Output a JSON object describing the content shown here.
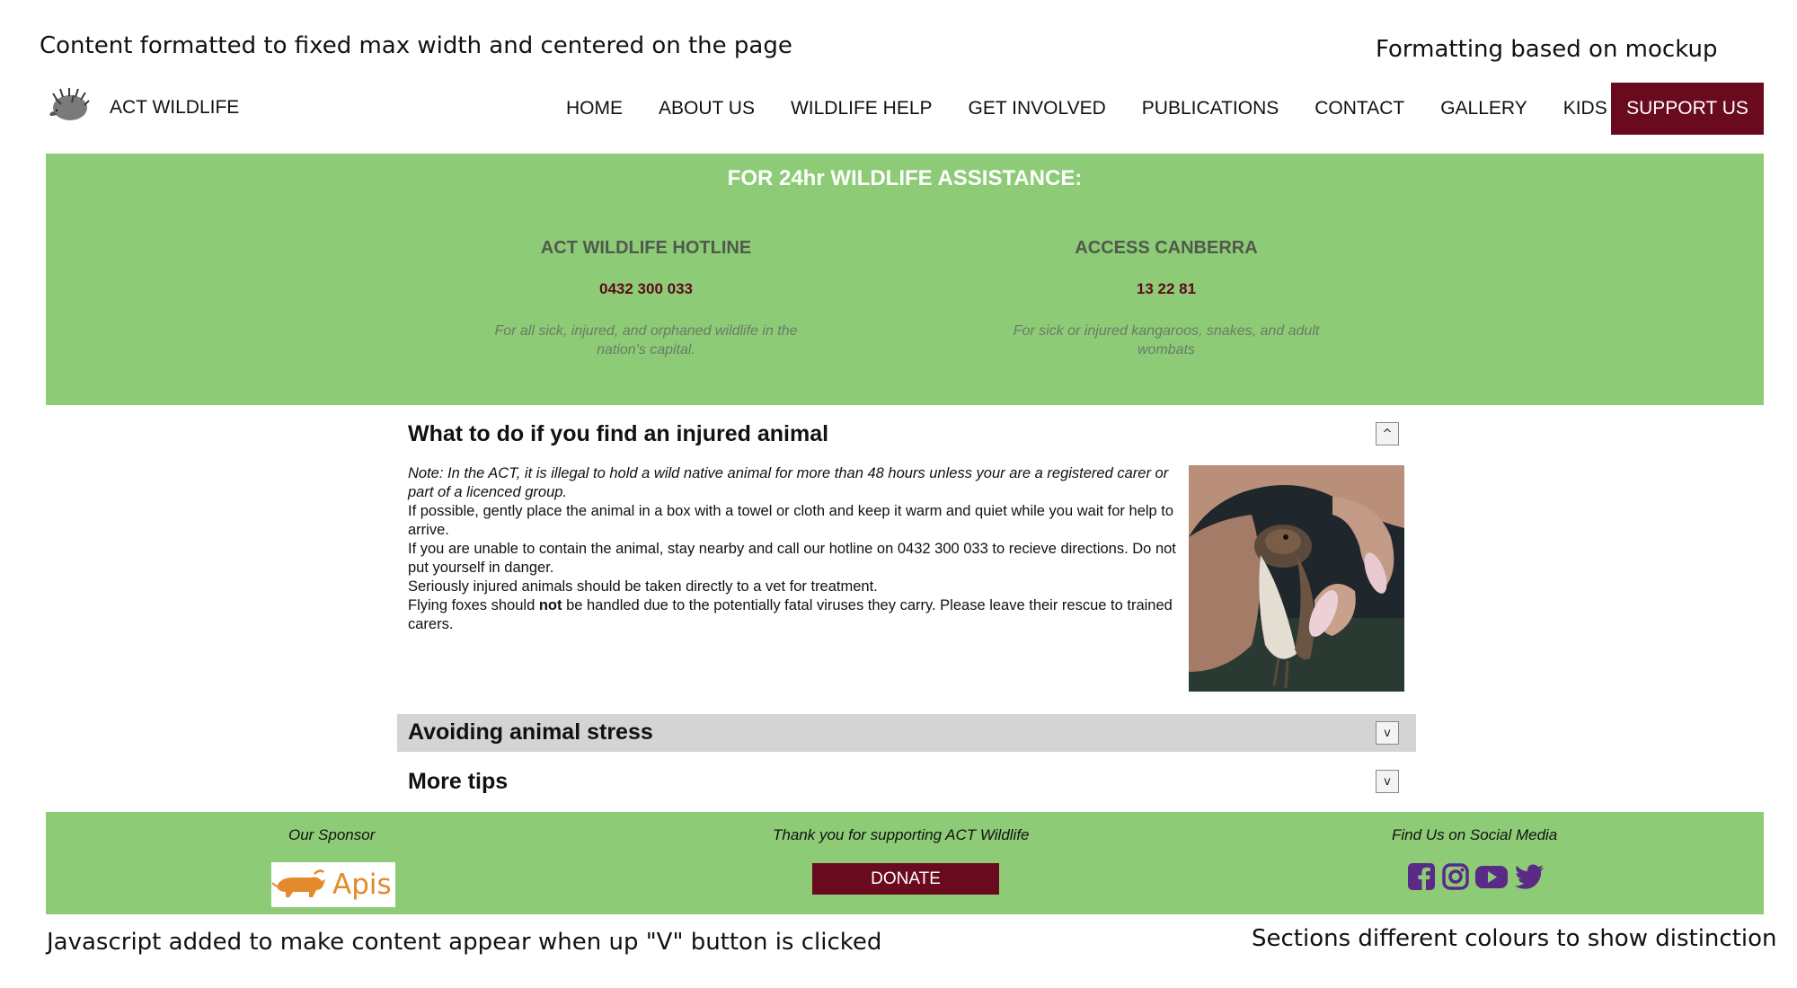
{
  "annotations": {
    "top_left": "Content formatted to fixed max width and centered on the page",
    "top_right": "Formatting based on mockup",
    "bottom_left": "Javascript added to make content appear when up \"V\" button is clicked",
    "bottom_right": "Sections different colours to show distinction"
  },
  "header": {
    "site_name": "ACT WILDLIFE",
    "nav": [
      "HOME",
      "ABOUT US",
      "WILDLIFE HELP",
      "GET INVOLVED",
      "PUBLICATIONS",
      "CONTACT",
      "GALLERY",
      "KIDS"
    ],
    "support_label": "SUPPORT US"
  },
  "assistance": {
    "heading": "FOR 24hr WILDLIFE ASSISTANCE:",
    "hotlines": [
      {
        "title": "ACT WILDLIFE HOTLINE",
        "number": "0432 300 033",
        "description": "For all sick, injured, and orphaned wildlife in the nation's capital."
      },
      {
        "title": "ACCESS CANBERRA",
        "number": "13 22 81",
        "description": "For sick or injured kangaroos, snakes, and adult wombats"
      }
    ]
  },
  "accordion": {
    "injured": {
      "title": "What to do if you find an injured animal",
      "toggle": "^",
      "note": "Note: In the ACT, it is illegal to hold a wild native animal for more than 48 hours unless your are a registered carer or part of a licenced group.",
      "lines": [
        "If possible, gently place the animal in a box with a towel or cloth and keep it warm and quiet while you wait for help to arrive.",
        "If you are unable to contain the animal, stay nearby and call our hotline on 0432 300 033 to recieve directions. Do not put yourself in danger.",
        "Seriously injured animals should be taken directly to a vet for treatment."
      ],
      "flying_fox_pre": "Flying foxes should ",
      "flying_fox_bold": "not",
      "flying_fox_post": " be handled due to the potentially fatal viruses they carry. Please leave their rescue to trained carers."
    },
    "stress": {
      "title": "Avoiding animal stress",
      "toggle": "v"
    },
    "tips": {
      "title": "More tips",
      "toggle": "v"
    }
  },
  "footer": {
    "sponsor_label": "Our Sponsor",
    "sponsor_name": "Apis",
    "thanks_label": "Thank you for supporting ACT Wildlife",
    "donate_label": "DONATE",
    "social_label": "Find Us on Social Media",
    "social_icons": [
      "facebook-icon",
      "instagram-icon",
      "youtube-icon",
      "twitter-icon"
    ]
  },
  "colors": {
    "green": "#8dcb77",
    "maroon": "#6a0a1f",
    "social": "#5a2a86",
    "sponsor_orange": "#e38a2d"
  }
}
